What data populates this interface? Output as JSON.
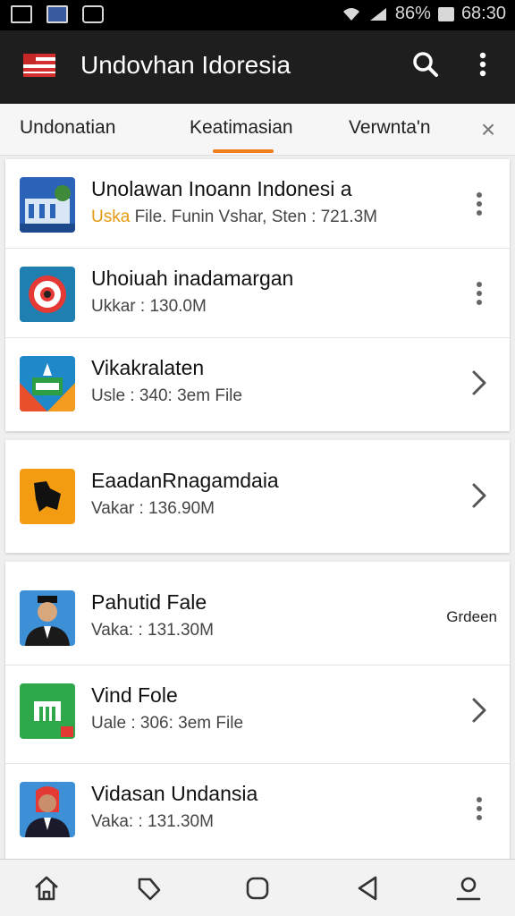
{
  "status_bar": {
    "battery": "86%",
    "time": "68:30",
    "left_icons": [
      "image-icon",
      "mail-icon",
      "clock-icon"
    ]
  },
  "app_bar": {
    "title": "Undovhan Idoresia",
    "icons": [
      "flag-icon",
      "search-icon",
      "more-vert-icon"
    ]
  },
  "tabs": [
    {
      "label": "Undonatian",
      "selected": false
    },
    {
      "label": "Keatimasian",
      "selected": true
    },
    {
      "label": "Verwnta'n",
      "selected": false
    }
  ],
  "list": [
    {
      "title": "Unolawan Inoann Indonesi a",
      "sub_highlight": "Uska",
      "sub": " File. Funin Vshar, Sten : 721.3M",
      "action": "more",
      "icon": "building-icon"
    },
    {
      "title": "Uhoiuah inadamargan",
      "sub": "Ukkar : 130.0M",
      "action": "more",
      "icon": "red-circle-icon"
    },
    {
      "title": "Vikakralaten",
      "sub": "Usle : 340: 3em File",
      "action": "chevron",
      "icon": "document-icon"
    },
    {
      "title": "EaadanRnagamdaia",
      "sub": "Vakar : 136.90M",
      "action": "chevron",
      "icon": "map-icon"
    },
    {
      "title": "Pahutid Fale",
      "sub": "Vaka: : 131.30M",
      "action": "tag",
      "tag": "Grdeen",
      "icon": "portrait-icon"
    },
    {
      "title": "Vind Fole",
      "sub": "Uale : 306: 3em File",
      "action": "chevron",
      "icon": "green-building-icon"
    },
    {
      "title": "Vidasan Undansia",
      "sub": "Vaka: : 131.30M",
      "action": "more",
      "icon": "portrait-red-icon"
    }
  ],
  "nav_bar": [
    "home-icon",
    "tag-icon",
    "recents-icon",
    "back-icon",
    "profile-icon"
  ],
  "colors": {
    "accent": "#ef7d1a",
    "app_bar": "#1e1e1e",
    "highlight_text": "#e69a12"
  }
}
